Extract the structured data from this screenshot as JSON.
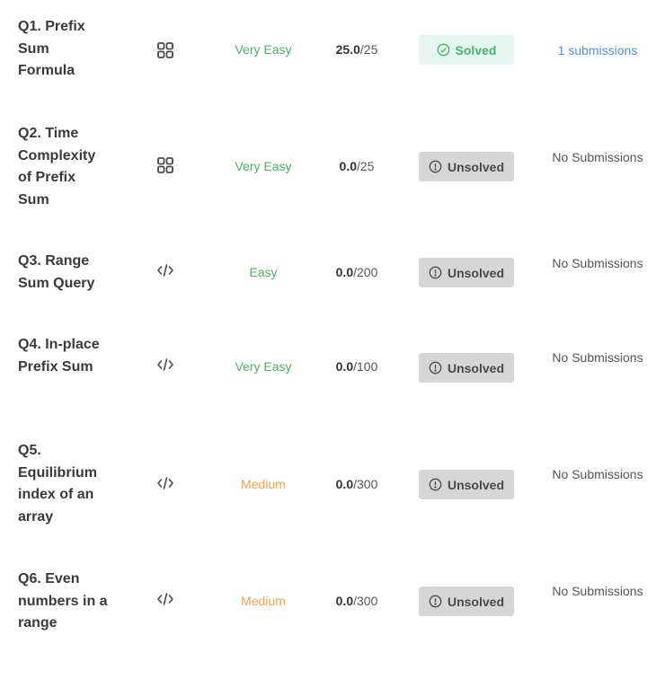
{
  "colors": {
    "very_easy": "#4caf67",
    "easy": "#4caf67",
    "medium": "#f0a04b",
    "solved_bg": "#e6f6ef",
    "solved_text": "#3fb56e",
    "unsolved_bg": "#d6d6d6",
    "link": "#4a8fe7"
  },
  "questions": [
    {
      "title": "Q1. Prefix Sum Formula",
      "type_icon": "grid-icon",
      "difficulty": "Very Easy",
      "score": "25.0",
      "max_score": "/25",
      "status": "Solved",
      "status_icon": "check-circle-icon",
      "submissions": "1 submissions"
    },
    {
      "title": "Q2. Time Complexity of Prefix Sum",
      "type_icon": "grid-icon",
      "difficulty": "Very Easy",
      "score": "0.0",
      "max_score": "/25",
      "status": "Unsolved",
      "status_icon": "info-circle-icon",
      "submissions": "No Submissions"
    },
    {
      "title": "Q3. Range Sum Query",
      "type_icon": "code-icon",
      "difficulty": "Easy",
      "score": "0.0",
      "max_score": "/200",
      "status": "Unsolved",
      "status_icon": "info-circle-icon",
      "submissions": "No Submissions"
    },
    {
      "title": "Q4. In-place Prefix Sum",
      "type_icon": "code-icon",
      "difficulty": "Very Easy",
      "score": "0.0",
      "max_score": "/100",
      "status": "Unsolved",
      "status_icon": "info-circle-icon",
      "submissions": "No Submissions"
    },
    {
      "title": "Q5. Equilibrium index of an array",
      "type_icon": "code-icon",
      "difficulty": "Medium",
      "score": "0.0",
      "max_score": "/300",
      "status": "Unsolved",
      "status_icon": "info-circle-icon",
      "submissions": "No Submissions"
    },
    {
      "title": "Q6. Even numbers in a range",
      "type_icon": "code-icon",
      "difficulty": "Medium",
      "score": "0.0",
      "max_score": "/300",
      "status": "Unsolved",
      "status_icon": "info-circle-icon",
      "submissions": "No Submissions"
    }
  ]
}
